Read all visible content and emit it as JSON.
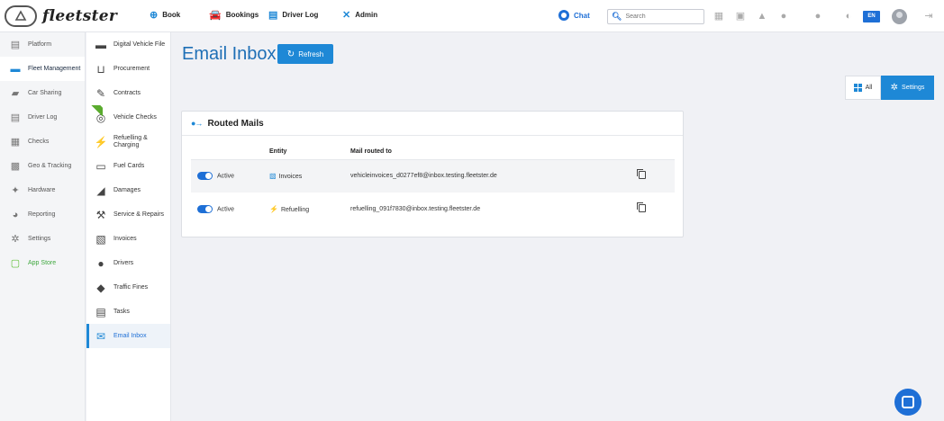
{
  "app": {
    "name": "fleetster"
  },
  "topnav": [
    {
      "key": "book",
      "label": "Book",
      "icon": "plus-circle-icon"
    },
    {
      "key": "bookings",
      "label": "Bookings",
      "icon": "car-icon"
    },
    {
      "key": "driver_log",
      "label": "Driver Log",
      "icon": "logbook-icon"
    },
    {
      "key": "admin",
      "label": "Admin",
      "icon": "tools-icon"
    }
  ],
  "chat": {
    "label": "Chat"
  },
  "search": {
    "placeholder": "Search"
  },
  "language": "EN",
  "sidebar": [
    {
      "label": "Platform",
      "icon": "platform-icon"
    },
    {
      "label": "Fleet Management",
      "icon": "fleet-icon",
      "active": true
    },
    {
      "label": "Car Sharing",
      "icon": "car-sharing-icon"
    },
    {
      "label": "Driver Log",
      "icon": "logbook-icon"
    },
    {
      "label": "Checks",
      "icon": "checks-icon"
    },
    {
      "label": "Geo & Tracking",
      "icon": "geo-icon"
    },
    {
      "label": "Hardware",
      "icon": "hardware-icon"
    },
    {
      "label": "Reporting",
      "icon": "reporting-icon"
    },
    {
      "label": "Settings",
      "icon": "settings-icon"
    },
    {
      "label": "App Store",
      "icon": "app-store-icon"
    }
  ],
  "subnav": [
    {
      "label": "Digital Vehicle File",
      "icon": "vehicle-file-icon"
    },
    {
      "label": "Procurement",
      "icon": "cart-icon"
    },
    {
      "label": "Contracts",
      "icon": "contract-icon"
    },
    {
      "label": "Vehicle Checks",
      "icon": "vehicle-check-icon",
      "badge": "NEW"
    },
    {
      "label": "Refuelling & Charging",
      "icon": "fuel-icon"
    },
    {
      "label": "Fuel Cards",
      "icon": "fuel-card-icon"
    },
    {
      "label": "Damages",
      "icon": "damage-icon"
    },
    {
      "label": "Service & Repairs",
      "icon": "wrench-icon"
    },
    {
      "label": "Invoices",
      "icon": "invoice-icon"
    },
    {
      "label": "Drivers",
      "icon": "driver-icon"
    },
    {
      "label": "Traffic Fines",
      "icon": "fine-icon"
    },
    {
      "label": "Tasks",
      "icon": "tasks-icon"
    },
    {
      "label": "Email Inbox",
      "icon": "email-icon",
      "active": true
    }
  ],
  "page": {
    "title": "Email Inbox",
    "refresh_label": "Refresh",
    "view_all_label": "All",
    "view_settings_label": "Settings"
  },
  "routed_mails": {
    "heading": "Routed Mails",
    "columns": {
      "status": "",
      "entity": "Entity",
      "routed_to": "Mail routed to"
    },
    "rows": [
      {
        "status": "Active",
        "entity": "Invoices",
        "email": "vehicleinvoices_d0277ef8@inbox.testing.fleetster.de"
      },
      {
        "status": "Active",
        "entity": "Refuelling",
        "email": "refuelling_091f7830@inbox.testing.fleetster.de"
      }
    ]
  },
  "colors": {
    "accent": "#1e88d6",
    "brand_blue": "#1e6fd6",
    "app_store_green": "#3fa83f"
  }
}
